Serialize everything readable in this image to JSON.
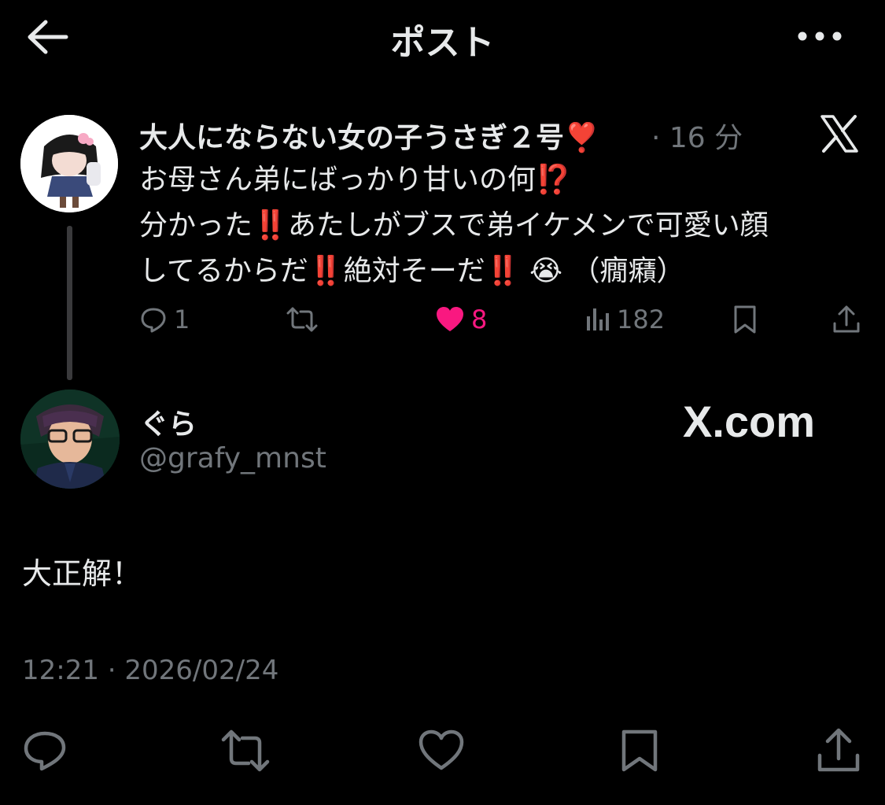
{
  "header": {
    "title": "ポスト",
    "back_icon": "arrow-left-icon",
    "more_icon": "more-horizontal-icon"
  },
  "parent_post": {
    "author": "大人にならない女の子うさぎ２号",
    "author_emoji": "❣️",
    "time": "· 16 分",
    "lines": [
      [
        "お母さん弟にばっかり甘いの何",
        "⁉️",
        ""
      ],
      [
        "分かった",
        "‼️",
        "あたしがブスで弟イケメンで可愛い顔"
      ],
      [
        "してるからだ",
        "‼️",
        "絶対そーだ",
        "‼️",
        " 😭 （癇癪）"
      ]
    ],
    "replies": "1",
    "likes": "8",
    "views": "182",
    "colors": {
      "like": "#f91880",
      "text": "#e7e9ea",
      "muted": "#71767b"
    }
  },
  "reply": {
    "author": "ぐら",
    "handle": "@grafy_mnst",
    "watermark": "X.com",
    "text": "大正解！",
    "timestamp": "12:21 · 2026/02/24"
  }
}
